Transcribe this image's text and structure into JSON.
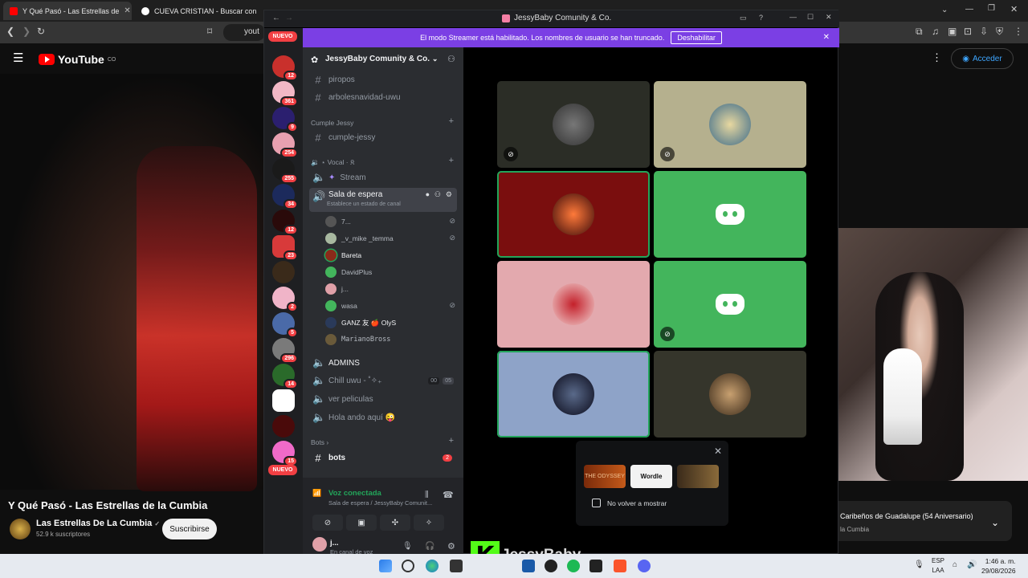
{
  "browser": {
    "tabs": [
      {
        "title": "Y Qué Pasó - Las Estrellas de",
        "active": true,
        "favicon_color": "#ff0000"
      },
      {
        "title": "CUEVA CRISTIAN - Buscar con Google",
        "active": false,
        "favicon_color": "#ffffff"
      }
    ],
    "url": "yout"
  },
  "youtube": {
    "logo_text": "YouTube",
    "country": "CO",
    "signin_label": "Acceder",
    "video_title": "Y Qué Pasó - Las Estrellas de la Cumbia",
    "channel_name": "Las Estrellas De La Cumbia",
    "verified_icon": "✓",
    "subscribers": "52.9 k suscriptores",
    "subscribe_label": "Suscribirse",
    "playlist_title": "Caribeños de Guadalupe (54 Aniversario)",
    "playlist_sub": "la Cumbia"
  },
  "discord": {
    "window_title": "JessyBaby Comunity & Co.",
    "streamer_banner": "El modo Streamer está habilitado. Los nombres de usuario se han truncado.",
    "disable_label": "Deshabilitar",
    "server_name": "JessyBaby Comunity & Co.",
    "nuevo": "NUEVO",
    "guild_badges": [
      "12",
      "361",
      "9",
      "254",
      "255",
      "34",
      "12",
      "23",
      "",
      "2",
      "5",
      "296",
      "14",
      "",
      "",
      "15"
    ],
    "channels_top": [
      "piropos",
      "arbolesnavidad-uwu"
    ],
    "cat_cumple": "Cumple Jessy",
    "ch_cumple": "cumple-jessy",
    "cat_vocal": "⋆ Vocal · 𝔎",
    "ch_stream": "Stream",
    "ch_sala": "Sala de espera",
    "sala_status": "Establece un estado de canal",
    "voice_users": [
      "7...",
      "_v_mike _temma",
      "Bareta",
      "DavidPlus",
      "j...",
      "wasa",
      "GANZ 友  🍎 OlyS",
      "MarianoBross"
    ],
    "ch_admins": "ADMINS",
    "ch_chill": "Chill uwu - ˚✧₊",
    "chill_counts": [
      "00",
      "05"
    ],
    "ch_peliculas": "ver peliculas",
    "ch_hola": "Hola ando aquí 😜",
    "cat_bots": "Bots",
    "ch_bots": "bots",
    "bots_badge": "2",
    "voice_connected": "Voz conectada",
    "voice_sub": "Sala de espera / JessyBaby Comunit...",
    "user_name": "j...",
    "user_status": "En canal de voz",
    "activities": [
      "THE ODYSSEY",
      "Wordle",
      ""
    ],
    "dont_show": "No volver a mostrar"
  },
  "overlay": {
    "kick_letter": "K",
    "streamer": "JessyBaby"
  },
  "taskbar": {
    "lang_top": "ESP",
    "lang_bottom": "LAA",
    "time": "1:46 a. m.",
    "date": "29/08/2026"
  }
}
